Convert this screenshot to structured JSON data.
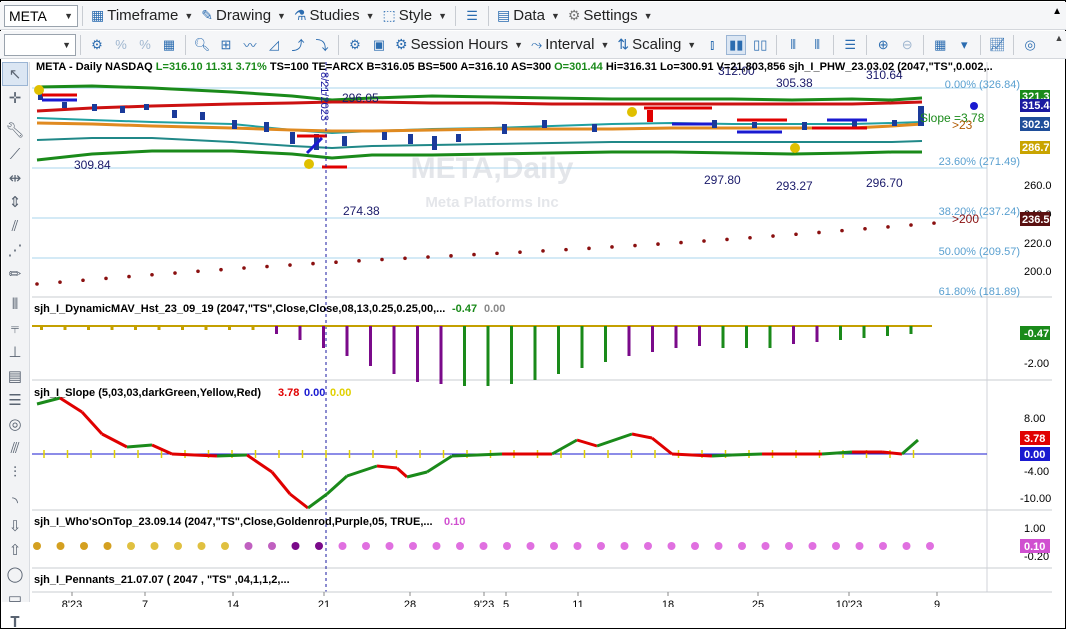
{
  "toolbar1": {
    "symbol": "META",
    "items": [
      {
        "name": "timeframe",
        "label": "Timeframe",
        "icon": "calendar-icon"
      },
      {
        "name": "drawing",
        "label": "Drawing",
        "icon": "pencil-icon"
      },
      {
        "name": "studies",
        "label": "Studies",
        "icon": "flask-icon"
      },
      {
        "name": "style",
        "label": "Style",
        "icon": "dashed-box-icon"
      },
      {
        "name": "data",
        "label": "Data",
        "icon": "grid-icon"
      },
      {
        "name": "settings",
        "label": "Settings",
        "icon": "gear-icon"
      }
    ]
  },
  "toolbar2": {
    "session_hours": "Session Hours",
    "interval": "Interval",
    "scaling": "Scaling"
  },
  "chart": {
    "header": "META - Daily  NASDAQ",
    "quote": {
      "L": "L=316.10",
      "chg": "11.31",
      "pct": "3.71%",
      "ts": "TS=100",
      "te": "TE=ARCX",
      "b": "B=316.05",
      "bs": "BS=500",
      "a": "A=316.10",
      "as": "AS=300",
      "o": "O=301.44",
      "hi": "Hi=316.31",
      "lo": "Lo=300.91",
      "v": "V=21,803,856",
      "study": "sjh_I_PHW_23.03.02 (2047,\"TS\",0.002,.."
    },
    "watermark1": "META,Daily",
    "watermark2": "Meta Platforms Inc",
    "annotations": {
      "a309": "309.84",
      "a296": "296.05",
      "a274": "274.38",
      "a312": "312.00",
      "a305": "305.38",
      "a310": "310.64",
      "a297": "297.80",
      "a293": "293.27",
      "a2967": "296.70",
      "slope": "Slope =3.78",
      "gt23": ">23",
      "gt200": ">200",
      "date_vert": "8/21/2023"
    },
    "fib": [
      "0.00% (326.84)",
      "23.60% (271.49)",
      "38.20% (237.24)",
      "50.00% (209.57)",
      "61.80% (181.89)"
    ],
    "price_scale": [
      "260.00",
      "240.00",
      "220.00",
      "200.00"
    ],
    "price_tags": [
      {
        "v": "321.37",
        "bg": "#1a8a1a"
      },
      {
        "v": "315.43",
        "bg": "#1a1aa0"
      },
      {
        "v": "302.93",
        "bg": "#1f4e9a"
      },
      {
        "v": "286.79",
        "bg": "#c9a400"
      },
      {
        "v": "236.59",
        "bg": "#5a1010"
      }
    ]
  },
  "panels": {
    "dmav": {
      "title": "sjh_I_DynamicMAV_Hst_23_09_19 (2047,\"TS\",Close,Close,08,13,0.25,0.25,00,...",
      "v1": "-0.47",
      "v2": "0.00",
      "scale": "-2.00",
      "tag": "-0.47"
    },
    "slope": {
      "title": "sjh_I_Slope (5,03,03,darkGreen,Yellow,Red)",
      "v1": "3.78",
      "v2": "0.00",
      "v3": "0.00",
      "scale": [
        "8.00",
        "-4.00",
        "-10.00"
      ],
      "tags": [
        "3.78",
        "0.00"
      ]
    },
    "wot": {
      "title": "sjh_I_Who'sOnTop_23.09.14 (2047,\"TS\",Close,Goldenrod,Purple,05,  TRUE,...",
      "v1": "0.10",
      "scale": [
        "1.00",
        "-0.20"
      ],
      "tag": "0.10"
    },
    "pennants": {
      "title": "sjh_I_Pennants_21.07.07 (  2047 ,  \"TS\" ,04,1,1,2,..."
    }
  },
  "xaxis": [
    "8'23",
    "7",
    "14",
    "21",
    "28",
    "9'23",
    "5",
    "11",
    "18",
    "25",
    "10'23",
    "9"
  ],
  "colors": {
    "accent": "#2b6cb0",
    "up": "#1a8a1a",
    "down": "#e00000",
    "purple": "#7a0a8a"
  }
}
